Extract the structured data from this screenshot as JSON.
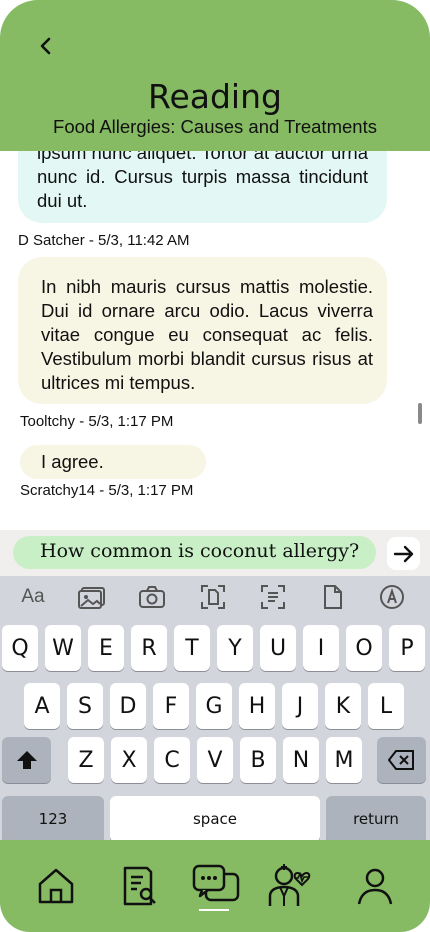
{
  "header": {
    "title": "Reading",
    "subtitle": "Food Allergies: Causes and Treatments"
  },
  "messages": [
    {
      "text": "ipsum nunc aliquet. Tortor at auctor urna nunc id. Cursus turpis massa tincidunt dui ut.",
      "author_time": "D Satcher - 5/3, 11:42 AM"
    },
    {
      "text": "In nibh mauris cursus mattis molestie. Dui id ornare arcu odio. Lacus viverra vitae congue eu consequat ac felis. Vestibulum morbi blandit cursus risus at ultrices mi tempus.",
      "author_time": "Tooltchy - 5/3, 1:17 PM"
    },
    {
      "text": "I agree.",
      "author_time": "Scratchy14 - 5/3, 1:17 PM"
    }
  ],
  "compose": {
    "value": "How common is coconut allergy?"
  },
  "keyboard": {
    "toolbar": [
      "Aa"
    ],
    "row1": [
      "Q",
      "W",
      "E",
      "R",
      "T",
      "Y",
      "U",
      "I",
      "O",
      "P"
    ],
    "row2": [
      "A",
      "S",
      "D",
      "F",
      "G",
      "H",
      "J",
      "K",
      "L"
    ],
    "row3": [
      "Z",
      "X",
      "C",
      "V",
      "B",
      "N",
      "M"
    ],
    "numbers_key": "123",
    "space_key": "space",
    "return_key": "return"
  },
  "icons": {
    "back": "chevron-left-icon",
    "send": "arrow-right-icon",
    "tabs": [
      "home-icon",
      "document-search-icon",
      "chat-icon",
      "doctor-icon",
      "profile-icon"
    ]
  },
  "colors": {
    "brand_green": "#86bb64",
    "compose_bubble": "#c8efc6",
    "message_cyan": "#e3f8f4",
    "message_cream": "#f7f5e4"
  }
}
